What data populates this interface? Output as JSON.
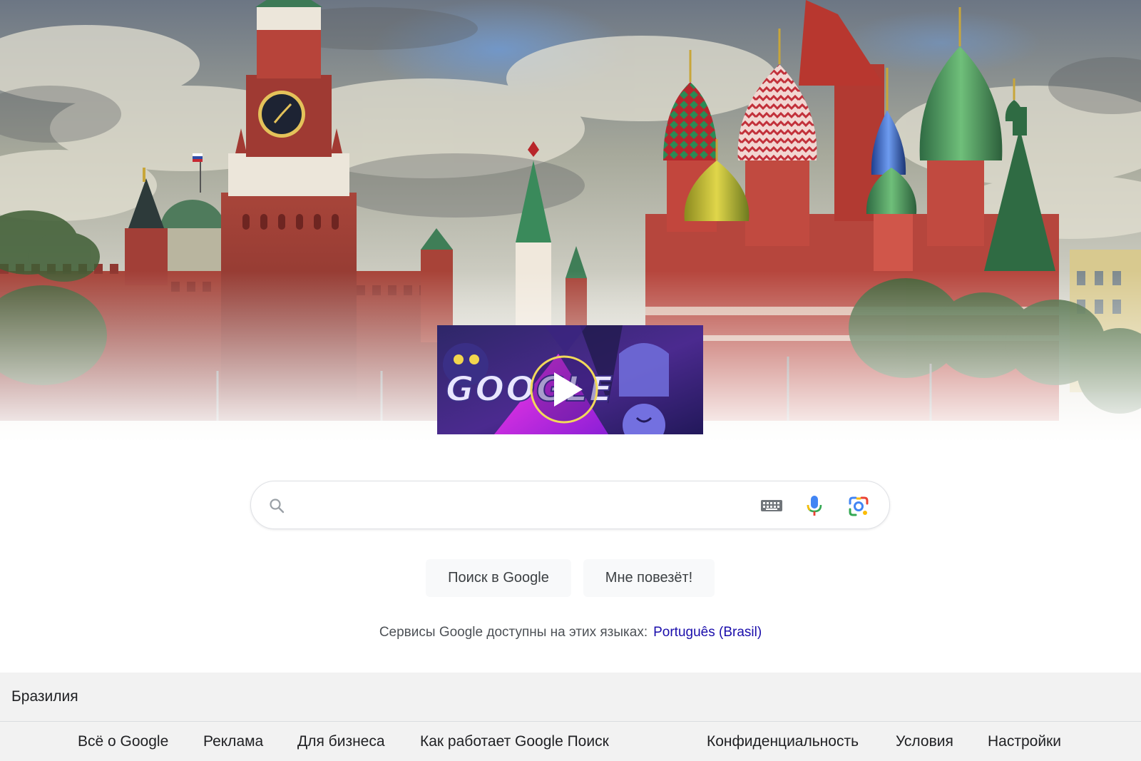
{
  "hero": {
    "scene": "Moscow Kremlin Spasskaya Tower and Saint Basil's Cathedral",
    "colors": {
      "sky_top": "#7d8a98",
      "cloud": "#d8d4c4",
      "brick": "#9b3b33",
      "fade": "#ffffff"
    }
  },
  "doodle": {
    "logo_text": "GOOGLE",
    "play_icon": "play-icon",
    "colors": {
      "bg_dark": "#2a1f5c",
      "purple": "#6a2fb8",
      "magenta": "#e21bd0",
      "play_ring": "#f2d95a"
    }
  },
  "search": {
    "value": "",
    "placeholder": "",
    "icons": [
      "search-icon",
      "keyboard-icon",
      "mic-icon",
      "lens-icon"
    ]
  },
  "buttons": {
    "search_label": "Поиск в Google",
    "lucky_label": "Мне повезёт!"
  },
  "language": {
    "prefix": "Сервисы Google доступны на этих языках:",
    "link": "Português (Brasil)",
    "link_color": "#1a0dab"
  },
  "footer": {
    "country": "Бразилия",
    "left_links": [
      "Всё о Google",
      "Реклама",
      "Для бизнеса",
      "Как работает Google Поиск"
    ],
    "right_links": [
      "Конфиденциальность",
      "Условия",
      "Настройки"
    ]
  }
}
